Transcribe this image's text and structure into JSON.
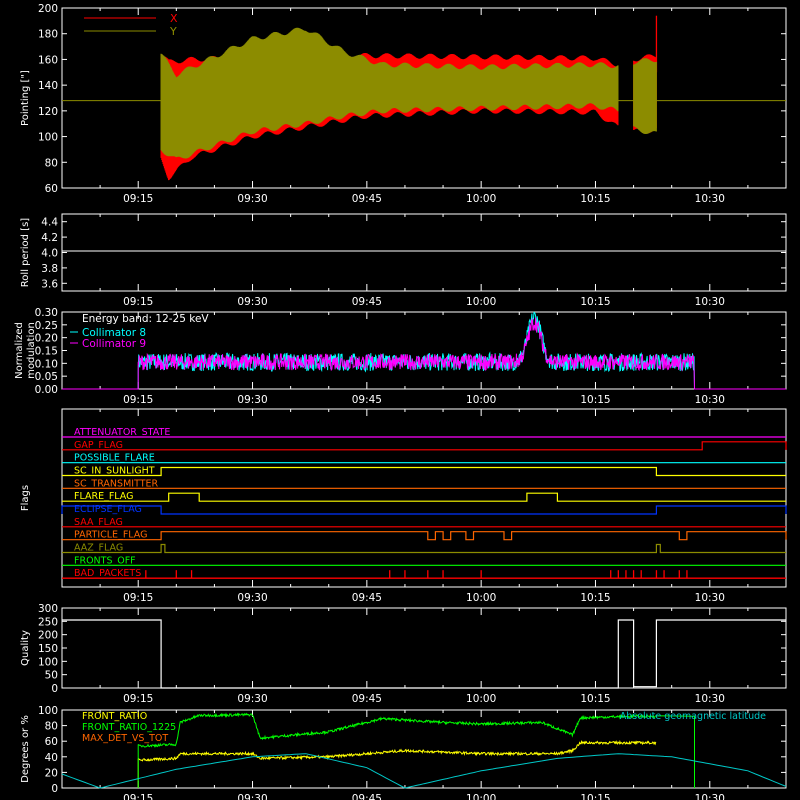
{
  "x_axis": {
    "range": [
      "09:05",
      "10:40"
    ],
    "ticks": [
      "09:15",
      "09:30",
      "09:45",
      "10:00",
      "10:15",
      "10:30"
    ]
  },
  "chart_data": [
    {
      "type": "area",
      "ylabel": "Pointing [\"]",
      "ylim": [
        60,
        200
      ],
      "yticks": [
        60,
        80,
        100,
        120,
        140,
        160,
        180,
        200
      ],
      "legend": "top-left",
      "series": [
        {
          "name": "X",
          "color": "#ff0000",
          "data_start": "09:18",
          "data_end": "10:23",
          "gap": [
            "10:18",
            "10:20"
          ],
          "envelope_time": [
            "09:18",
            "09:19",
            "09:22",
            "09:30",
            "09:45",
            "10:00",
            "10:15",
            "10:18",
            "10:20",
            "10:23"
          ],
          "envelope_upper": [
            167,
            160,
            162,
            164,
            165,
            164,
            163,
            158,
            162,
            165
          ],
          "envelope_lower": [
            80,
            66,
            82,
            98,
            114,
            118,
            117,
            105,
            102,
            103
          ],
          "spike": {
            "time": "10:23",
            "value": 194
          }
        },
        {
          "name": "Y",
          "color": "#8c8c00",
          "data_start": "09:18",
          "data_end": "10:23",
          "gap": [
            "10:18",
            "10:20"
          ],
          "envelope_time": [
            "09:18",
            "09:20",
            "09:30",
            "09:37",
            "09:42",
            "09:47",
            "10:00",
            "10:15",
            "10:18",
            "10:20",
            "10:23"
          ],
          "envelope_upper": [
            166,
            150,
            178,
            186,
            168,
            158,
            156,
            158,
            157,
            160,
            162
          ],
          "envelope_lower": [
            88,
            80,
            102,
            108,
            114,
            118,
            120,
            122,
            118,
            104,
            100
          ]
        }
      ],
      "reference_line": {
        "value": 128,
        "color": "#8c8c00"
      }
    },
    {
      "type": "line",
      "ylabel": "Roll period [s]",
      "ylim": [
        3.5,
        4.5
      ],
      "yticks": [
        "3.6",
        "3.8",
        "4.0",
        "4.2",
        "4.4"
      ],
      "series": [
        {
          "name": "",
          "color": "#ffffff",
          "value": 4.02
        }
      ]
    },
    {
      "type": "line",
      "ylabel": [
        "Normalized",
        "modulation"
      ],
      "ylim": [
        0.0,
        0.3
      ],
      "yticks": [
        "0.00",
        "0.05",
        "0.10",
        "0.15",
        "0.20",
        "0.25",
        "0.30"
      ],
      "legend_title": "Energy band: 12-25 keV",
      "series": [
        {
          "name": "Collimator 8",
          "color": "#00ffff",
          "start": "09:15",
          "end": "10:28",
          "baseline": 0.105,
          "noise": 0.05,
          "peak": {
            "time": "10:07",
            "value": 0.28
          }
        },
        {
          "name": "Collimator 9",
          "color": "#ff00ff",
          "start": "09:15",
          "end": "10:28",
          "baseline": 0.105,
          "noise": 0.045,
          "peak": {
            "time": "10:07",
            "value": 0.26
          }
        }
      ]
    },
    {
      "type": "flags",
      "ylabel": "Flags",
      "rows": [
        {
          "name": "ATTENUATOR_STATE",
          "color": "#ff00ff",
          "high": []
        },
        {
          "name": "GAP_FLAG",
          "color": "#ff0000",
          "high": [
            [
              "10:29",
              "10:40"
            ]
          ],
          "start_high": false
        },
        {
          "name": "POSSIBLE_FLARE",
          "color": "#00ffff",
          "high": []
        },
        {
          "name": "SC_IN_SUNLIGHT",
          "color": "#ffff00",
          "high": [
            [
              "09:18",
              "10:23"
            ]
          ]
        },
        {
          "name": "SC_TRANSMITTER",
          "color": "#ff6600",
          "high": []
        },
        {
          "name": "FLARE_FLAG",
          "color": "#ffff00",
          "high": [
            [
              "09:19",
              "09:23"
            ],
            [
              "10:06",
              "10:10"
            ]
          ]
        },
        {
          "name": "ECLIPSE_FLAG",
          "color": "#0033ff",
          "high": [
            [
              "09:05",
              "09:18"
            ],
            [
              "10:23",
              "10:40"
            ]
          ]
        },
        {
          "name": "SAA_FLAG",
          "color": "#ff0000",
          "high": []
        },
        {
          "name": "PARTICLE_FLAG",
          "color": "#ff6600",
          "high": [
            [
              "09:18",
              "09:53"
            ],
            [
              "09:54",
              "09:55"
            ],
            [
              "09:56",
              "09:58"
            ],
            [
              "09:59",
              "10:03"
            ],
            [
              "10:04",
              "10:26"
            ],
            [
              "10:27",
              "10:40"
            ]
          ]
        },
        {
          "name": "AAZ_FLAG",
          "color": "#8c8c00",
          "high": [
            [
              "09:18",
              "09:18.5"
            ],
            [
              "10:23",
              "10:23.5"
            ]
          ]
        },
        {
          "name": "FRONTS_OFF",
          "color": "#00ff00",
          "high": []
        },
        {
          "name": "BAD_PACKETS",
          "color": "#ff0000",
          "spikes": [
            "09:16",
            "09:20",
            "09:22",
            "09:48",
            "09:50",
            "09:53",
            "09:55",
            "10:00",
            "10:17",
            "10:18",
            "10:19",
            "10:20",
            "10:21",
            "10:23",
            "10:24",
            "10:26",
            "10:27"
          ]
        }
      ]
    },
    {
      "type": "line",
      "ylabel": "Quality",
      "ylim": [
        0,
        300
      ],
      "yticks": [
        0,
        50,
        100,
        150,
        200,
        250,
        300
      ],
      "series": [
        {
          "name": "",
          "color": "#ffffff",
          "segments": [
            [
              "09:05",
              "09:18",
              255
            ],
            [
              "09:18",
              "10:18",
              0
            ],
            [
              "10:18",
              "10:20",
              255
            ],
            [
              "10:20",
              "10:23",
              5
            ],
            [
              "10:23",
              "10:40",
              255
            ]
          ]
        }
      ]
    },
    {
      "type": "line",
      "ylabel": "Degrees or %",
      "ylim": [
        0,
        100
      ],
      "yticks": [
        0,
        20,
        40,
        60,
        80,
        100
      ],
      "series": [
        {
          "name": "FRONT_RATIO",
          "color": "#ffff00",
          "t": [
            "09:15",
            "09:16",
            "09:20",
            "09:20.5",
            "09:30",
            "09:31",
            "09:40",
            "09:50",
            "09:55",
            "10:00",
            "10:10",
            "10:12",
            "10:13",
            "10:20",
            "10:23"
          ],
          "v": [
            36,
            36,
            38,
            44,
            44,
            38,
            40,
            48,
            46,
            44,
            44,
            48,
            58,
            58,
            58
          ]
        },
        {
          "name": "FRONT_RATIO_1225",
          "color": "#00ff00",
          "t": [
            "09:15",
            "09:16",
            "09:20",
            "09:20.5",
            "09:23",
            "09:30",
            "09:31",
            "09:40",
            "09:47",
            "09:55",
            "10:00",
            "10:08",
            "10:12",
            "10:13",
            "10:20",
            "10:23"
          ],
          "v": [
            54,
            54,
            56,
            84,
            93,
            94,
            64,
            72,
            89,
            84,
            82,
            84,
            68,
            90,
            92,
            92
          ],
          "drop": {
            "time": "10:28",
            "value": 0
          }
        },
        {
          "name": "MAX_DET_VS_TOT",
          "color": "#ff6600",
          "t": [],
          "v": []
        },
        {
          "name": "Absolute geomagnetic latitude",
          "color": "#00c8c8",
          "t": [
            "09:05",
            "09:10",
            "09:20",
            "09:30",
            "09:37",
            "09:45",
            "09:50",
            "10:00",
            "10:10",
            "10:18",
            "10:25",
            "10:35",
            "10:40"
          ],
          "v": [
            18,
            0,
            24,
            40,
            44,
            26,
            0,
            22,
            38,
            44,
            40,
            22,
            2
          ]
        }
      ]
    }
  ]
}
